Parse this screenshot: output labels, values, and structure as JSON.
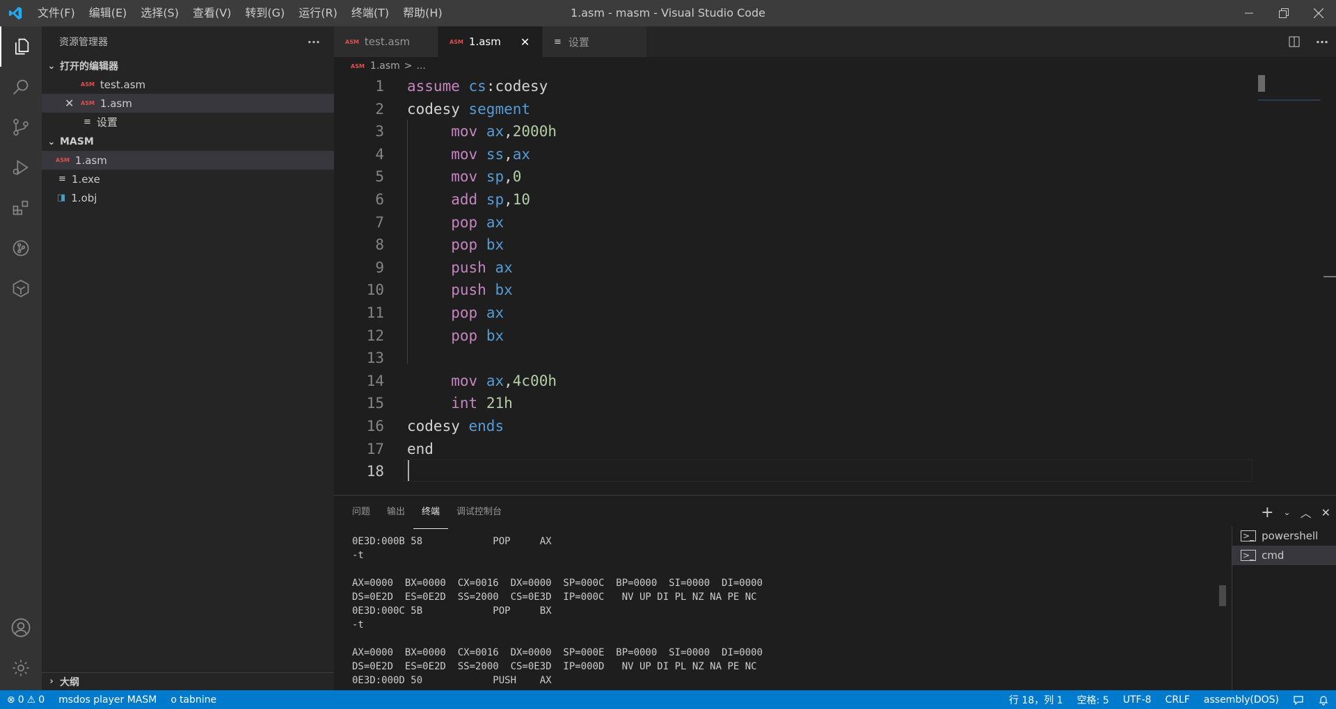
{
  "titlebar": {
    "menu": [
      "文件(F)",
      "编辑(E)",
      "选择(S)",
      "查看(V)",
      "转到(G)",
      "运行(R)",
      "终端(T)",
      "帮助(H)"
    ],
    "window_title": "1.asm - masm - Visual Studio Code"
  },
  "sidebar": {
    "header": "资源管理器",
    "more": "···",
    "open_editors_title": "打开的编辑器",
    "open_editors": [
      {
        "tag": "ASM",
        "label": "test.asm"
      },
      {
        "tag": "ASM",
        "label": "1.asm"
      },
      {
        "tag": "",
        "label": "设置"
      }
    ],
    "folder_title": "MASM",
    "files": [
      {
        "tag": "ASM",
        "label": "1.asm"
      },
      {
        "tag": "",
        "label": "1.exe"
      },
      {
        "tag": "",
        "label": "1.obj"
      }
    ],
    "outline_title": "大纲"
  },
  "tabs": [
    {
      "tag": "ASM",
      "label": "test.asm"
    },
    {
      "tag": "ASM",
      "label": "1.asm"
    },
    {
      "tag": "",
      "label": "设置"
    }
  ],
  "breadcrumb": {
    "file": "1.asm",
    "sep": ">",
    "rest": "..."
  },
  "editor": {
    "lines": [
      {
        "n": "1",
        "tokens": [
          [
            "kw-pink",
            "assume"
          ],
          [
            "ident",
            " "
          ],
          [
            "reg",
            "cs"
          ],
          [
            "ident",
            ":codesy"
          ]
        ]
      },
      {
        "n": "2",
        "tokens": [
          [
            "ident",
            "codesy "
          ],
          [
            "kw-blue",
            "segment"
          ]
        ]
      },
      {
        "n": "3",
        "tokens": [
          [
            "ident",
            "     "
          ],
          [
            "kw-pink",
            "mov"
          ],
          [
            "ident",
            " "
          ],
          [
            "reg",
            "ax"
          ],
          [
            "ident",
            ","
          ],
          [
            "num",
            "2000h"
          ]
        ]
      },
      {
        "n": "4",
        "tokens": [
          [
            "ident",
            "     "
          ],
          [
            "kw-pink",
            "mov"
          ],
          [
            "ident",
            " "
          ],
          [
            "reg",
            "ss"
          ],
          [
            "ident",
            ","
          ],
          [
            "reg",
            "ax"
          ]
        ]
      },
      {
        "n": "5",
        "tokens": [
          [
            "ident",
            "     "
          ],
          [
            "kw-pink",
            "mov"
          ],
          [
            "ident",
            " "
          ],
          [
            "reg",
            "sp"
          ],
          [
            "ident",
            ","
          ],
          [
            "num",
            "0"
          ]
        ]
      },
      {
        "n": "6",
        "tokens": [
          [
            "ident",
            "     "
          ],
          [
            "kw-pink",
            "add"
          ],
          [
            "ident",
            " "
          ],
          [
            "reg",
            "sp"
          ],
          [
            "ident",
            ","
          ],
          [
            "num",
            "10"
          ]
        ]
      },
      {
        "n": "7",
        "tokens": [
          [
            "ident",
            "     "
          ],
          [
            "kw-pink",
            "pop"
          ],
          [
            "ident",
            " "
          ],
          [
            "reg",
            "ax"
          ]
        ]
      },
      {
        "n": "8",
        "tokens": [
          [
            "ident",
            "     "
          ],
          [
            "kw-pink",
            "pop"
          ],
          [
            "ident",
            " "
          ],
          [
            "reg",
            "bx"
          ]
        ]
      },
      {
        "n": "9",
        "tokens": [
          [
            "ident",
            "     "
          ],
          [
            "kw-pink",
            "push"
          ],
          [
            "ident",
            " "
          ],
          [
            "reg",
            "ax"
          ]
        ]
      },
      {
        "n": "10",
        "tokens": [
          [
            "ident",
            "     "
          ],
          [
            "kw-pink",
            "push"
          ],
          [
            "ident",
            " "
          ],
          [
            "reg",
            "bx"
          ]
        ]
      },
      {
        "n": "11",
        "tokens": [
          [
            "ident",
            "     "
          ],
          [
            "kw-pink",
            "pop"
          ],
          [
            "ident",
            " "
          ],
          [
            "reg",
            "ax"
          ]
        ]
      },
      {
        "n": "12",
        "tokens": [
          [
            "ident",
            "     "
          ],
          [
            "kw-pink",
            "pop"
          ],
          [
            "ident",
            " "
          ],
          [
            "reg",
            "bx"
          ]
        ]
      },
      {
        "n": "13",
        "tokens": []
      },
      {
        "n": "14",
        "tokens": [
          [
            "ident",
            "     "
          ],
          [
            "kw-pink",
            "mov"
          ],
          [
            "ident",
            " "
          ],
          [
            "reg",
            "ax"
          ],
          [
            "ident",
            ","
          ],
          [
            "num",
            "4c00h"
          ]
        ]
      },
      {
        "n": "15",
        "tokens": [
          [
            "ident",
            "     "
          ],
          [
            "kw-pink",
            "int"
          ],
          [
            "ident",
            " "
          ],
          [
            "num",
            "21h"
          ]
        ]
      },
      {
        "n": "16",
        "tokens": [
          [
            "ident",
            "codesy "
          ],
          [
            "kw-blue",
            "ends"
          ]
        ]
      },
      {
        "n": "17",
        "tokens": [
          [
            "ident",
            "end"
          ]
        ]
      },
      {
        "n": "18",
        "tokens": []
      }
    ]
  },
  "panel": {
    "tabs": [
      "问题",
      "输出",
      "终端",
      "调试控制台"
    ],
    "active_tab": 2,
    "terminal_lines": [
      "0E3D:000B 58            POP     AX",
      "-t",
      "",
      "AX=0000  BX=0000  CX=0016  DX=0000  SP=000C  BP=0000  SI=0000  DI=0000",
      "DS=0E2D  ES=0E2D  SS=2000  CS=0E3D  IP=000C   NV UP DI PL NZ NA PE NC",
      "0E3D:000C 5B            POP     BX",
      "-t",
      "",
      "AX=0000  BX=0000  CX=0016  DX=0000  SP=000E  BP=0000  SI=0000  DI=0000",
      "DS=0E2D  ES=0E2D  SS=2000  CS=0E3D  IP=000D   NV UP DI PL NZ NA PE NC",
      "0E3D:000D 50            PUSH    AX"
    ],
    "terminals": [
      "powershell",
      "cmd"
    ]
  },
  "statusbar": {
    "errors": "0",
    "warnings": "0",
    "left_items": [
      "msdos player MASM",
      "tabnine"
    ],
    "right_items": [
      "行 18，列 1",
      "空格: 5",
      "UTF-8",
      "CRLF",
      "assembly(DOS)"
    ]
  },
  "colors": {
    "accent": "#007acc",
    "asm_tag": "#e04e4e"
  }
}
